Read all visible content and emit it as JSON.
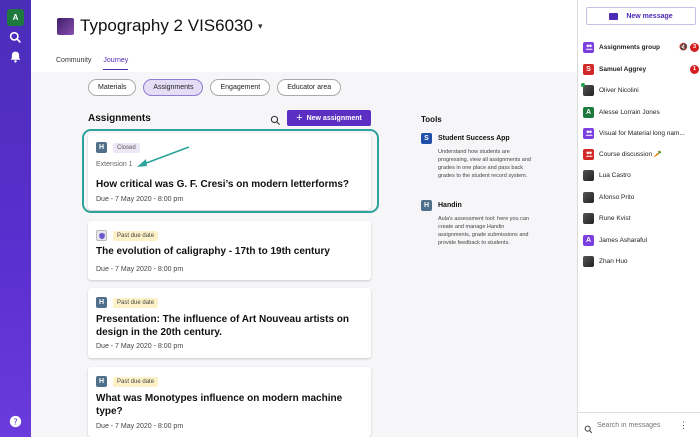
{
  "rail": {
    "avatar_letter": "A"
  },
  "course": {
    "title": "Typography 2 VIS6030",
    "caret": "▾"
  },
  "top_tabs": [
    {
      "label": "Community"
    },
    {
      "label": "Journey",
      "active": true
    }
  ],
  "sub_tabs": [
    {
      "label": "Materials"
    },
    {
      "label": "Assignments",
      "active": true
    },
    {
      "label": "Engagement"
    },
    {
      "label": "Educator area"
    }
  ],
  "assignments": {
    "heading": "Assignments",
    "new_button": "New assignment",
    "cards": [
      {
        "icon": "H",
        "status": "Closed",
        "extension": "Extension 1",
        "title": "How critical was G. F. Cresi’s on modern letterforms?",
        "due": "Due - 7 May 2020 - 8:00 pm"
      },
      {
        "icon": "shield",
        "status": "Past due date",
        "title": "The evolution of caligraphy - 17th to 19th century",
        "due": "Due - 7 May 2020 - 8:00 pm"
      },
      {
        "icon": "H",
        "status": "Past due date",
        "title": "Presentation: The influence of Art Nouveau artists on design in the 20th century.",
        "due": "Due - 7 May 2020 - 8:00 pm"
      },
      {
        "icon": "H",
        "status": "Past due date",
        "title": "What was Monotypes influence on modern machine type?",
        "due": "Due - 7 May 2020 - 8:00 pm"
      }
    ]
  },
  "tools": {
    "heading": "Tools",
    "items": [
      {
        "icon": "S",
        "color": "#1f4fa8",
        "name": "Student Success App",
        "desc": "Understand how students are progressing, view all assignments and grades in one place and pass back grades to the student record system."
      },
      {
        "icon": "H",
        "color": "#4f6f8a",
        "name": "Handin",
        "desc": "Aula's assessment tool: here you can create and manage Handin assignments, grade submissions and provide feedback to students."
      }
    ]
  },
  "messages": {
    "new_button": "New message",
    "conversations": [
      {
        "name": "Assignments group",
        "avatar": "group",
        "color": "#7b3fe0",
        "bold": true,
        "muted": true,
        "unread": "3"
      },
      {
        "name": "Samuel Aggrey",
        "avatar": "S",
        "color": "#d32828",
        "bold": true,
        "unread": "1"
      },
      {
        "name": "Oliver Nicolini",
        "avatar": "photo",
        "online": true
      },
      {
        "name": "Alesse Lorrain Jones",
        "avatar": "A",
        "color": "#1e7a3c"
      },
      {
        "name": "Visual for Material long nam...",
        "avatar": "group",
        "color": "#7b3fe0"
      },
      {
        "name": "Course discussion 🥕",
        "avatar": "group",
        "color": "#d32828"
      },
      {
        "name": "Lua Castro",
        "avatar": "photo"
      },
      {
        "name": "Afonso Prito",
        "avatar": "photo"
      },
      {
        "name": "Rune Kvist",
        "avatar": "photo"
      },
      {
        "name": "James Asharaful",
        "avatar": "A",
        "color": "#7b3fe0"
      },
      {
        "name": "Zhan Huo",
        "avatar": "photo"
      }
    ],
    "search_placeholder": "Search in messages"
  },
  "colors": {
    "brand": "#4d2bb5",
    "highlight": "#2ca39a"
  }
}
